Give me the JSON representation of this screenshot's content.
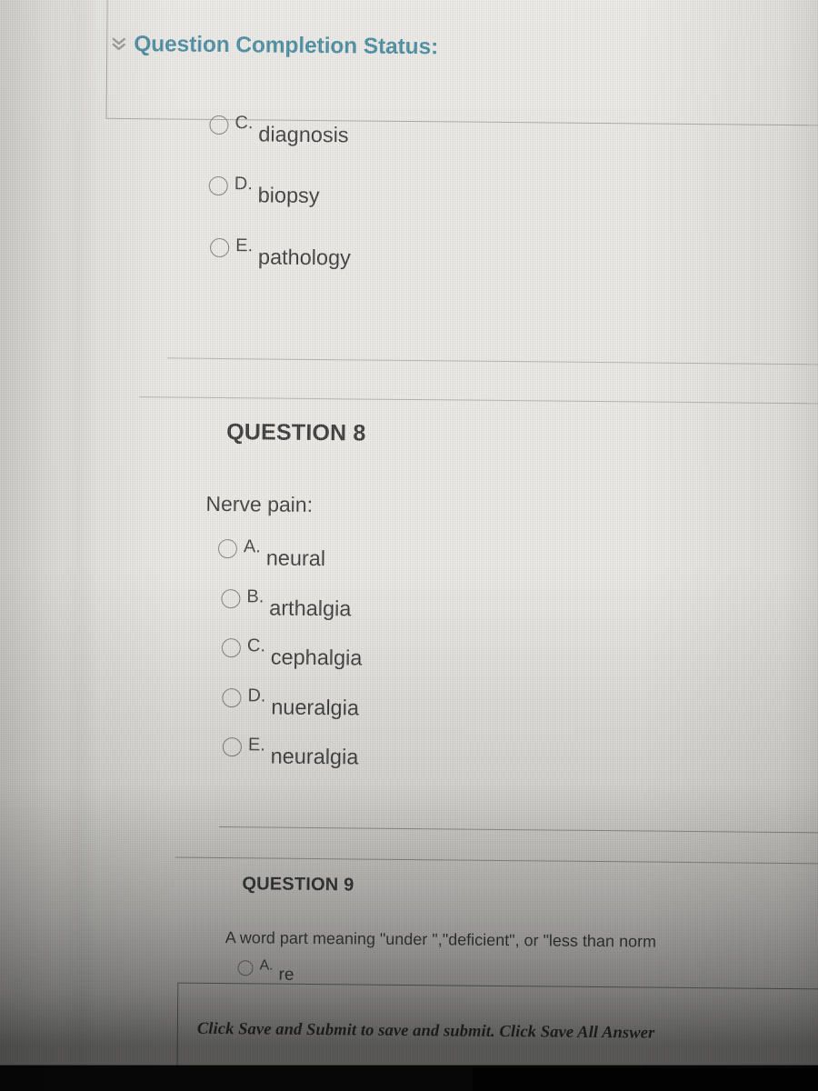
{
  "status_panel": {
    "title": "Question Completion Status:",
    "chevron_icon": "double-chevron-down-icon"
  },
  "question_7_partial": {
    "options": [
      {
        "letter": "C.",
        "text": "diagnosis"
      },
      {
        "letter": "D.",
        "text": "biopsy"
      },
      {
        "letter": "E.",
        "text": "pathology"
      }
    ]
  },
  "question_8": {
    "heading": "QUESTION 8",
    "stem": "Nerve pain:",
    "options": [
      {
        "letter": "A.",
        "text": "neural"
      },
      {
        "letter": "B.",
        "text": "arthalgia"
      },
      {
        "letter": "C.",
        "text": "cephalgia"
      },
      {
        "letter": "D.",
        "text": "nueralgia"
      },
      {
        "letter": "E.",
        "text": "neuralgia"
      }
    ]
  },
  "question_9": {
    "heading": "QUESTION 9",
    "stem": "A word part meaning \"under \",\"deficient\", or \"less than norm",
    "options": [
      {
        "letter": "A.",
        "text": "re"
      }
    ]
  },
  "footer": {
    "text": "Click Save and Submit to save and submit. Click Save All Answer"
  },
  "colors": {
    "heading_teal": "#2a7890",
    "page_background": "#e9e8e3",
    "text": "#232323",
    "separator": "#a9a7a2",
    "radio_border": "#6d6d6d"
  }
}
